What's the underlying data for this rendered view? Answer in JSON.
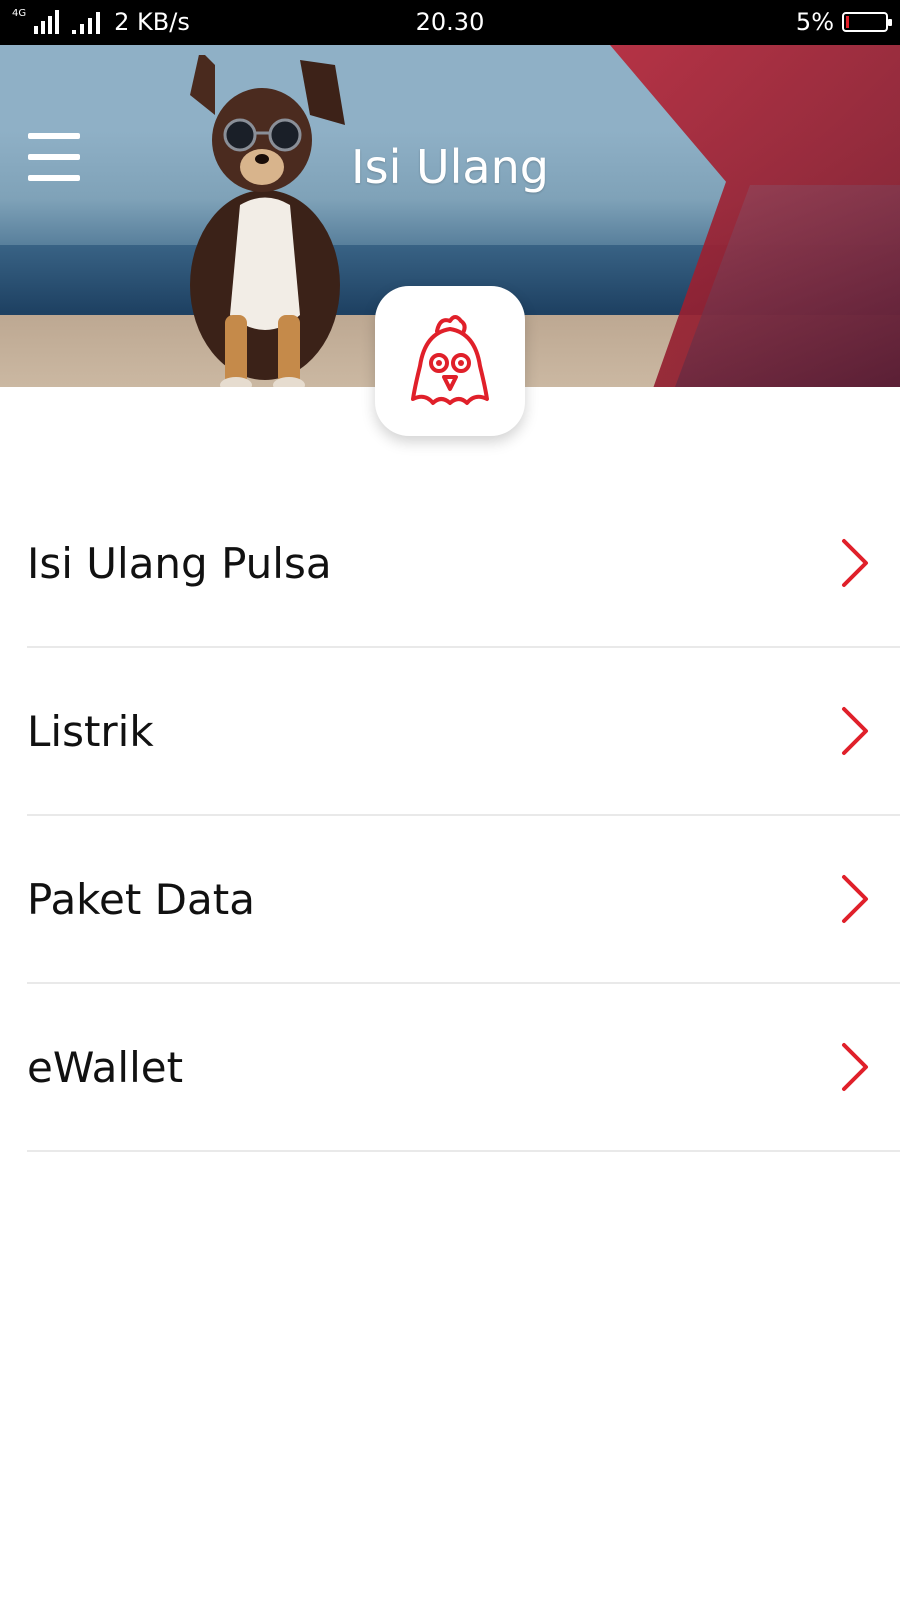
{
  "status_bar": {
    "network_badge": "4G",
    "speed": "2 KB/s",
    "time": "20.30",
    "battery_percent": "5%",
    "battery_level": 0.05
  },
  "header": {
    "title": "Isi Ulang"
  },
  "menu": {
    "items": [
      {
        "label": "Isi Ulang Pulsa"
      },
      {
        "label": "Listrik"
      },
      {
        "label": "Paket Data"
      },
      {
        "label": "eWallet"
      }
    ]
  },
  "colors": {
    "accent": "#e0202a",
    "status_bar_bg": "#000000",
    "divider": "#e9e9e9"
  },
  "icons": {
    "menu": "hamburger-icon",
    "logo": "chicken-logo-icon",
    "chevron": "chevron-right-icon"
  }
}
